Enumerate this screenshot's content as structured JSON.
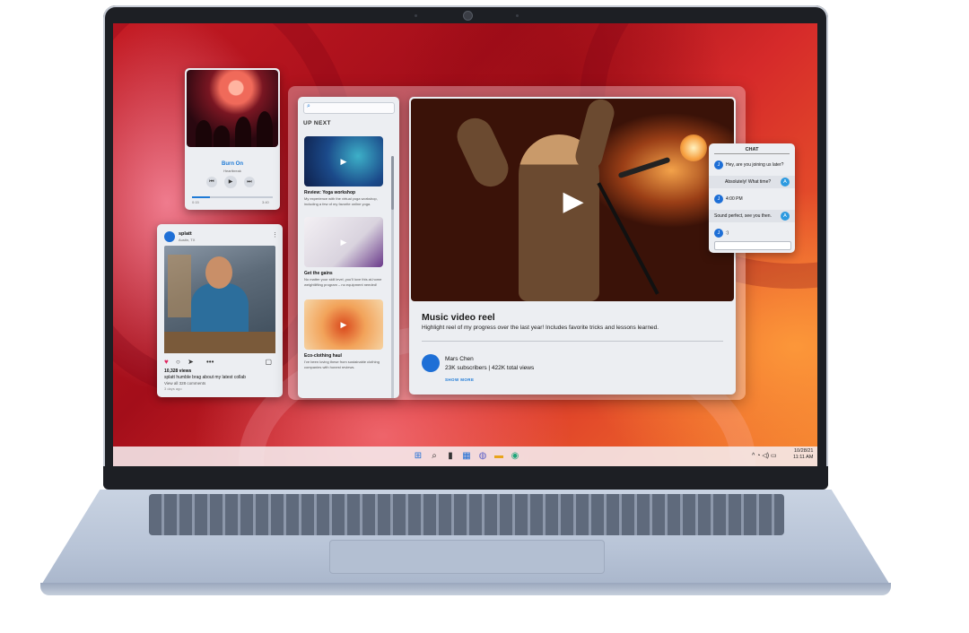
{
  "music": {
    "song_title": "Burn On",
    "artist": "Heartbreak",
    "time_start": "0:15",
    "time_end": "3:40",
    "progress": 0.22,
    "controls": [
      "⏮",
      "▶",
      "⏭"
    ]
  },
  "social": {
    "username": "splatt",
    "location": "Austin, TX",
    "views": "10,328 views",
    "caption": "splatt humble brag about my latest collab",
    "comments": "View all 328 comments",
    "posted": "3 days ago",
    "actions": [
      "♥",
      "○",
      "➤",
      "•••",
      "▢"
    ]
  },
  "upnext": {
    "search_placeholder": "",
    "title": "UP NEXT",
    "videos": [
      {
        "title": "Review: Yoga workshop",
        "desc": "My experience with the virtual yoga workshop, including a few of my favorite online yoga."
      },
      {
        "title": "Get the gains",
        "desc": "No matter your skill level, you'll love this at-home weightlifting program – no equipment needed!"
      },
      {
        "title": "Eco-clothing haul",
        "desc": "I've been loving these from sustainable clothing companies with honest reviews."
      }
    ]
  },
  "video": {
    "title": "Music video reel",
    "description": "Highlight reel of my progress over the last year! Includes favorite tricks and lessons learned.",
    "channel": "Mars Chen",
    "stats": "23K subscribers | 422K total views",
    "show_more": "SHOW MORE"
  },
  "chat": {
    "title": "CHAT",
    "messages": [
      {
        "from": "J",
        "text": "Hey, are you joining us later?",
        "side": "left"
      },
      {
        "from": "A",
        "text": "Absolutely! What time?",
        "side": "right"
      },
      {
        "from": "J",
        "text": "4:00 PM",
        "side": "left"
      },
      {
        "from": "A",
        "text": "Sound perfect, see you then.",
        "side": "right"
      },
      {
        "from": "J",
        "text": ":)",
        "side": "left"
      }
    ]
  },
  "taskbar": {
    "icons": [
      "⊞",
      "⌕",
      "▮",
      "▦",
      "◍",
      "▬",
      "◉"
    ],
    "tray": "^  ◔  ◁)  ▭",
    "date": "10/28/21",
    "time": "11:11 AM"
  },
  "colors": {
    "accent": "#1e7ad6",
    "wallpaper_red": "#c41a22",
    "wallpaper_orange": "#f27f2e"
  }
}
